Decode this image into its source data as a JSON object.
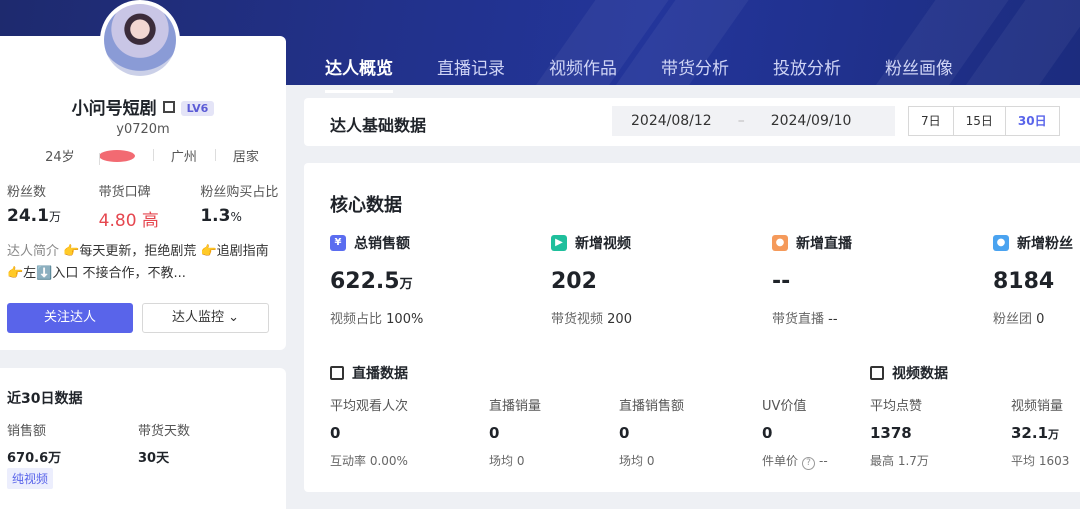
{
  "tabs": [
    "达人概览",
    "直播记录",
    "视频作品",
    "带货分析",
    "投放分析",
    "粉丝画像"
  ],
  "profile": {
    "name": "小问号短剧",
    "level": "LV6",
    "uid": "y0720m",
    "age": "24岁",
    "city": "广州",
    "category": "居家",
    "stats": [
      {
        "label": "粉丝数",
        "value": "24.1",
        "unit": "万"
      },
      {
        "label": "带货口碑",
        "value": "4.80 高",
        "unit": ""
      },
      {
        "label": "粉丝购买占比",
        "value": "1.3",
        "unit": "%"
      }
    ],
    "bio_label": "达人简介",
    "bio_text": "👉每天更新，拒绝剧荒 👉追剧指南👉左⬇️入口 不接合作，不教...",
    "follow_label": "关注达人",
    "monitor_label": "达人监控 ⌄"
  },
  "last30": {
    "title": "近30日数据",
    "sales_label": "销售额",
    "sales_value": "670.6万",
    "days_label": "带货天数",
    "days_value": "30天",
    "tag": "纯视频"
  },
  "basic": {
    "title": "达人基础数据",
    "date_start": "2024/08/12",
    "date_sep": "–",
    "date_end": "2024/09/10",
    "ranges": [
      "7日",
      "15日",
      "30日"
    ],
    "active_range": "30日"
  },
  "core": {
    "title": "核心数据",
    "metrics": [
      {
        "label": "总销售额",
        "value": "622.5",
        "unit": "万",
        "sub_label": "视频占比",
        "sub_value": "100%"
      },
      {
        "label": "新增视频",
        "value": "202",
        "unit": "",
        "sub_label": "带货视频",
        "sub_value": "200"
      },
      {
        "label": "新增直播",
        "value": "--",
        "unit": "",
        "sub_label": "带货直播",
        "sub_value": "--"
      },
      {
        "label": "新增粉丝",
        "value": "8184",
        "unit": "",
        "sub_label": "粉丝团",
        "sub_value": "0"
      }
    ],
    "live_title": "直播数据",
    "live": [
      {
        "label": "平均观看人次",
        "value": "0",
        "sub": "互动率 0.00%"
      },
      {
        "label": "直播销量",
        "value": "0",
        "sub": "场均 0"
      },
      {
        "label": "直播销售额",
        "value": "0",
        "sub": "场均 0"
      },
      {
        "label": "UV价值",
        "value": "0",
        "sub_label": "件单价",
        "sub_value": "--"
      }
    ],
    "video_title": "视频数据",
    "video": [
      {
        "label": "平均点赞",
        "value": "1378",
        "unit": "",
        "sub": "最高 1.7万"
      },
      {
        "label": "视频销量",
        "value": "32.1",
        "unit": "万",
        "sub": "平均 1603"
      }
    ]
  }
}
